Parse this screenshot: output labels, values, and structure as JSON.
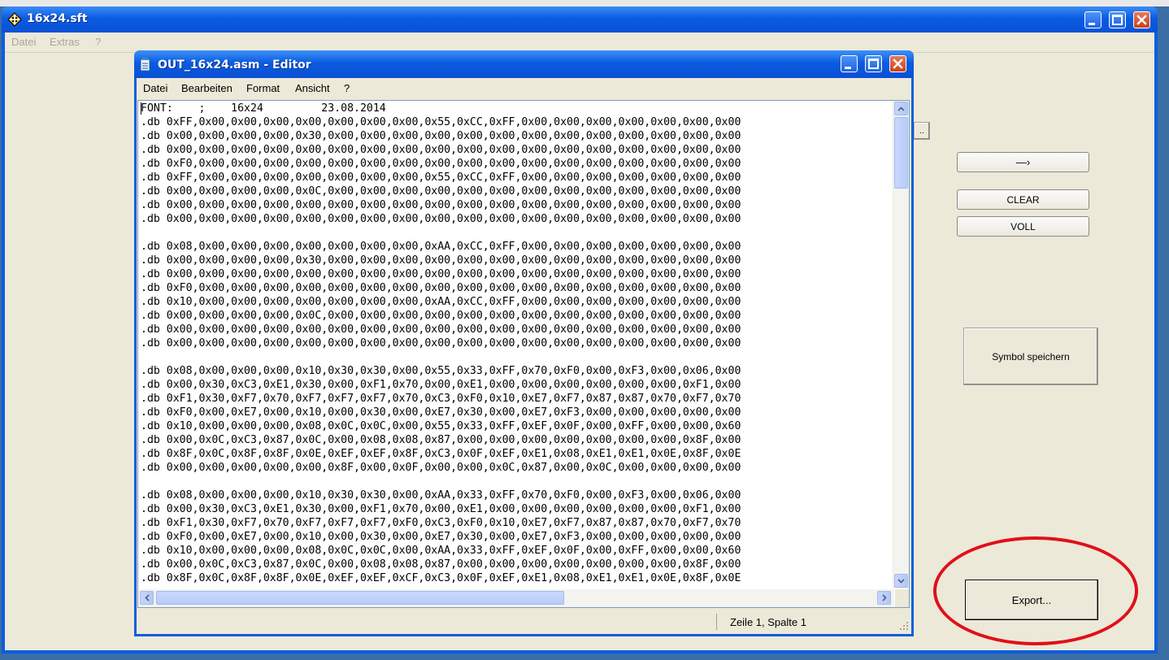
{
  "app": {
    "title": "16x24.sft",
    "menu": [
      "Datei",
      "Extras",
      "?"
    ]
  },
  "buttons": {
    "arrow": "—›",
    "clear": "CLEAR",
    "voll": "VOLL",
    "symbol_speichern": "Symbol speichern",
    "export": "Export..."
  },
  "editor": {
    "title": "OUT_16x24.asm - Editor",
    "menu": [
      "Datei",
      "Bearbeiten",
      "Format",
      "Ansicht",
      "?"
    ],
    "status": "Zeile 1, Spalte 1",
    "lines": [
      "FONT:    ;    16x24         23.08.2014",
      ".db 0xFF,0x00,0x00,0x00,0x00,0x00,0x00,0x00,0x55,0xCC,0xFF,0x00,0x00,0x00,0x00,0x00,0x00,0x00",
      ".db 0x00,0x00,0x00,0x00,0x30,0x00,0x00,0x00,0x00,0x00,0x00,0x00,0x00,0x00,0x00,0x00,0x00,0x00",
      ".db 0x00,0x00,0x00,0x00,0x00,0x00,0x00,0x00,0x00,0x00,0x00,0x00,0x00,0x00,0x00,0x00,0x00,0x00",
      ".db 0xF0,0x00,0x00,0x00,0x00,0x00,0x00,0x00,0x00,0x00,0x00,0x00,0x00,0x00,0x00,0x00,0x00,0x00",
      ".db 0xFF,0x00,0x00,0x00,0x00,0x00,0x00,0x00,0x55,0xCC,0xFF,0x00,0x00,0x00,0x00,0x00,0x00,0x00",
      ".db 0x00,0x00,0x00,0x00,0x0C,0x00,0x00,0x00,0x00,0x00,0x00,0x00,0x00,0x00,0x00,0x00,0x00,0x00",
      ".db 0x00,0x00,0x00,0x00,0x00,0x00,0x00,0x00,0x00,0x00,0x00,0x00,0x00,0x00,0x00,0x00,0x00,0x00",
      ".db 0x00,0x00,0x00,0x00,0x00,0x00,0x00,0x00,0x00,0x00,0x00,0x00,0x00,0x00,0x00,0x00,0x00,0x00",
      "",
      ".db 0x08,0x00,0x00,0x00,0x00,0x00,0x00,0x00,0xAA,0xCC,0xFF,0x00,0x00,0x00,0x00,0x00,0x00,0x00",
      ".db 0x00,0x00,0x00,0x00,0x30,0x00,0x00,0x00,0x00,0x00,0x00,0x00,0x00,0x00,0x00,0x00,0x00,0x00",
      ".db 0x00,0x00,0x00,0x00,0x00,0x00,0x00,0x00,0x00,0x00,0x00,0x00,0x00,0x00,0x00,0x00,0x00,0x00",
      ".db 0xF0,0x00,0x00,0x00,0x00,0x00,0x00,0x00,0x00,0x00,0x00,0x00,0x00,0x00,0x00,0x00,0x00,0x00",
      ".db 0x10,0x00,0x00,0x00,0x00,0x00,0x00,0x00,0xAA,0xCC,0xFF,0x00,0x00,0x00,0x00,0x00,0x00,0x00",
      ".db 0x00,0x00,0x00,0x00,0x0C,0x00,0x00,0x00,0x00,0x00,0x00,0x00,0x00,0x00,0x00,0x00,0x00,0x00",
      ".db 0x00,0x00,0x00,0x00,0x00,0x00,0x00,0x00,0x00,0x00,0x00,0x00,0x00,0x00,0x00,0x00,0x00,0x00",
      ".db 0x00,0x00,0x00,0x00,0x00,0x00,0x00,0x00,0x00,0x00,0x00,0x00,0x00,0x00,0x00,0x00,0x00,0x00",
      "",
      ".db 0x08,0x00,0x00,0x00,0x10,0x30,0x30,0x00,0x55,0x33,0xFF,0x70,0xF0,0x00,0xF3,0x00,0x06,0x00",
      ".db 0x00,0x30,0xC3,0xE1,0x30,0x00,0xF1,0x70,0x00,0xE1,0x00,0x00,0x00,0x00,0x00,0x00,0xF1,0x00",
      ".db 0xF1,0x30,0xF7,0x70,0xF7,0xF7,0xF7,0x70,0xC3,0xF0,0x10,0xE7,0xF7,0x87,0x87,0x70,0xF7,0x70",
      ".db 0xF0,0x00,0xE7,0x00,0x10,0x00,0x30,0x00,0xE7,0x30,0x00,0xE7,0xF3,0x00,0x00,0x00,0x00,0x00",
      ".db 0x10,0x00,0x00,0x00,0x08,0x0C,0x0C,0x00,0x55,0x33,0xFF,0xEF,0x0F,0x00,0xFF,0x00,0x00,0x60",
      ".db 0x00,0x0C,0xC3,0x87,0x0C,0x00,0x08,0x08,0x87,0x00,0x00,0x00,0x00,0x00,0x00,0x00,0x8F,0x00",
      ".db 0x8F,0x0C,0x8F,0x8F,0x0E,0xEF,0xEF,0x8F,0xC3,0x0F,0xEF,0xE1,0x08,0xE1,0xE1,0x0E,0x8F,0x0E",
      ".db 0x00,0x00,0x00,0x00,0x00,0x8F,0x00,0x0F,0x00,0x00,0x0C,0x87,0x00,0x0C,0x00,0x00,0x00,0x00",
      "",
      ".db 0x08,0x00,0x00,0x00,0x10,0x30,0x30,0x00,0xAA,0x33,0xFF,0x70,0xF0,0x00,0xF3,0x00,0x06,0x00",
      ".db 0x00,0x30,0xC3,0xE1,0x30,0x00,0xF1,0x70,0x00,0xE1,0x00,0x00,0x00,0x00,0x00,0x00,0xF1,0x00",
      ".db 0xF1,0x30,0xF7,0x70,0xF7,0xF7,0xF7,0xF0,0xC3,0xF0,0x10,0xE7,0xF7,0x87,0x87,0x70,0xF7,0x70",
      ".db 0xF0,0x00,0xE7,0x00,0x10,0x00,0x30,0x00,0xE7,0x30,0x00,0xE7,0xF3,0x00,0x00,0x00,0x00,0x00",
      ".db 0x10,0x00,0x00,0x00,0x08,0x0C,0x0C,0x00,0xAA,0x33,0xFF,0xEF,0x0F,0x00,0xFF,0x00,0x00,0x60",
      ".db 0x00,0x0C,0xC3,0x87,0x0C,0x00,0x08,0x08,0x87,0x00,0x00,0x00,0x00,0x00,0x00,0x00,0x8F,0x00",
      ".db 0x8F,0x0C,0x8F,0x8F,0x0E,0xEF,0xEF,0xCF,0xC3,0x0F,0xEF,0xE1,0x08,0xE1,0xE1,0x0E,0x8F,0x0E"
    ]
  },
  "colors": {
    "xp_blue": "#0a5ee0",
    "window_face": "#ece9d8",
    "highlight_ring": "#e0101a"
  }
}
